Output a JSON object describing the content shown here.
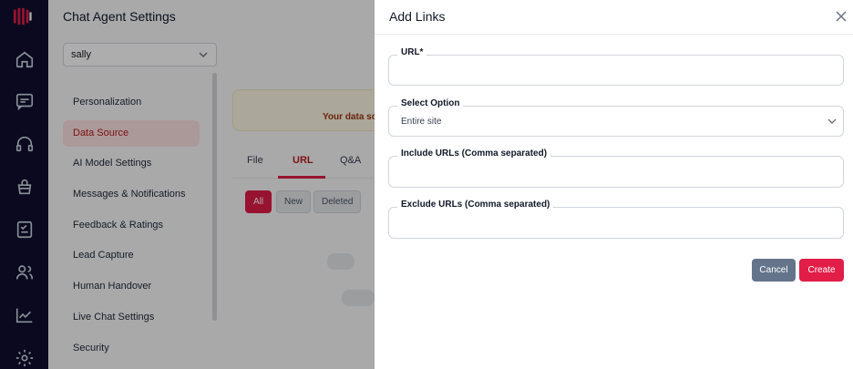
{
  "page": {
    "title": "Chat Agent Settings",
    "agent_select_value": "sally",
    "menu_items": [
      "Personalization",
      "Data Source",
      "AI Model Settings",
      "Messages & Notifications",
      "Feedback & Ratings",
      "Lead Capture",
      "Human Handover",
      "Live Chat Settings",
      "Security"
    ],
    "active_menu_item": "Data Source",
    "banner_text": "Your data so",
    "tabs": [
      "File",
      "URL",
      "Q&A"
    ],
    "active_tab": "URL",
    "filters": [
      "All",
      "New",
      "Deleted"
    ],
    "active_filter": "All"
  },
  "modal": {
    "title": "Add Links",
    "fields": {
      "url": {
        "label": "URL*",
        "value": ""
      },
      "select_option": {
        "label": "Select Option",
        "value": "Entire site"
      },
      "include_urls": {
        "label": "Include URLs (Comma separated)",
        "value": ""
      },
      "exclude_urls": {
        "label": "Exclude URLs (Comma separated)",
        "value": ""
      }
    },
    "cancel_label": "Cancel",
    "create_label": "Create"
  },
  "colors": {
    "rail": "#0f0e2e",
    "accent": "#e11d48",
    "cancel": "#64748b"
  },
  "icons": [
    "logo-icon",
    "home-icon",
    "chat-icon",
    "headset-icon",
    "basket-icon",
    "checklist-icon",
    "users-icon",
    "analytics-icon",
    "gear-icon",
    "close-icon",
    "chevron-down-icon"
  ]
}
